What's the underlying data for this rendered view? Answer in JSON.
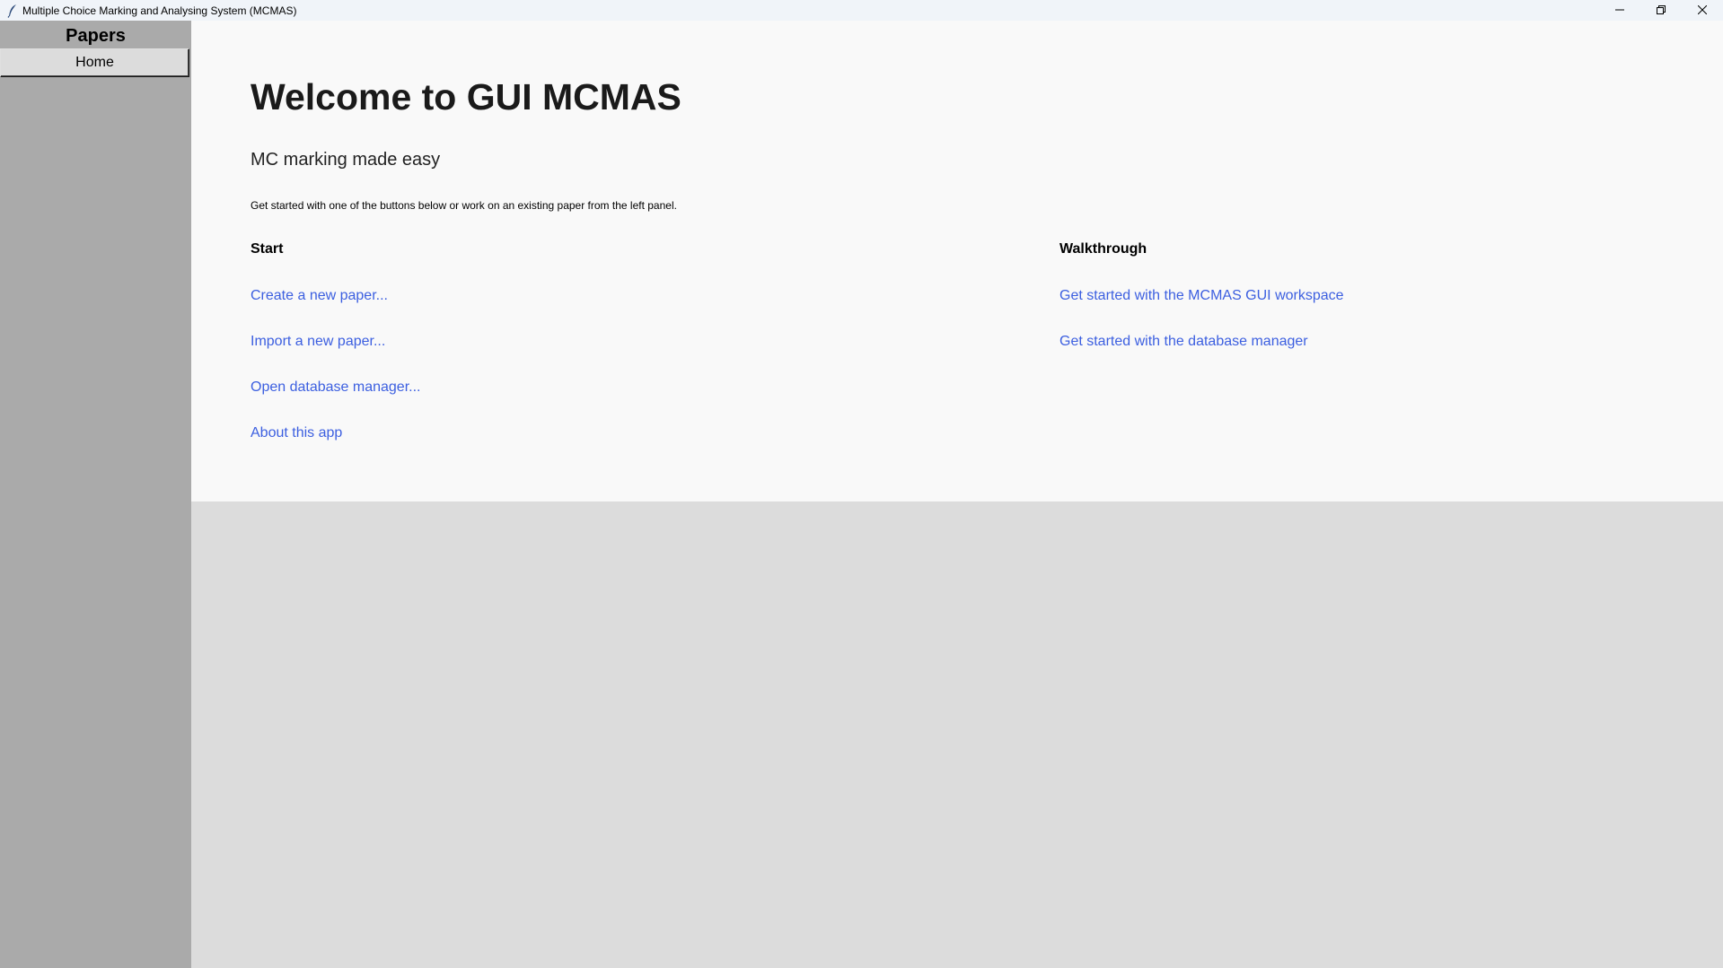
{
  "window": {
    "title": "Multiple Choice Marking and Analysing System (MCMAS)"
  },
  "sidebar": {
    "title": "Papers",
    "items": [
      {
        "label": "Home"
      }
    ]
  },
  "main": {
    "heading": "Welcome to GUI MCMAS",
    "tagline": "MC marking made easy",
    "intro": "Get started with one of the buttons below or work on an existing paper from the left panel.",
    "start": {
      "heading": "Start",
      "links": [
        {
          "label": "Create a new paper..."
        },
        {
          "label": "Import a new paper..."
        },
        {
          "label": "Open database manager..."
        },
        {
          "label": "About this app"
        }
      ]
    },
    "walkthrough": {
      "heading": "Walkthrough",
      "links": [
        {
          "label": "Get started with the MCMAS GUI workspace"
        },
        {
          "label": "Get started with the database manager"
        }
      ]
    }
  },
  "colors": {
    "link": "#3c5fe0",
    "sidebar_bg": "#aaaaaa",
    "main_bg": "#f9f9f9",
    "window_bg": "#dcdcdc",
    "titlebar_bg": "#f0f4f9"
  },
  "icons": {
    "app": "feather-icon",
    "minimize": "minimize-icon",
    "restore": "restore-icon",
    "close": "close-icon"
  }
}
